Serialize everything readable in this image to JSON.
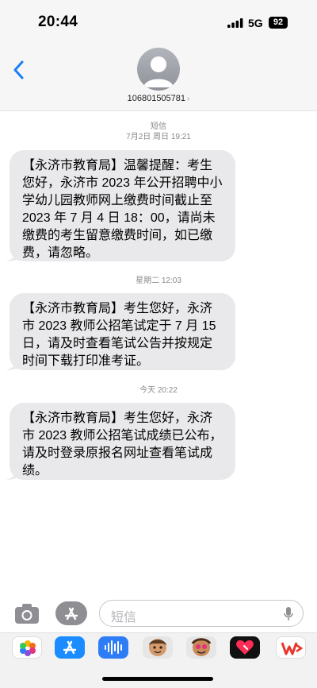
{
  "status_bar": {
    "time": "20:44",
    "network": "5G",
    "battery": "92"
  },
  "header": {
    "contact_name": "106801505781",
    "chevron": "›"
  },
  "messages": [
    {
      "meta_line1": "短信",
      "meta_line2": "7月2日 周日 19:21",
      "text": "【永济市教育局】温馨提醒：考生您好，永济市 2023 年公开招聘中小学幼儿园教师网上缴费时间截止至 2023 年 7 月 4 日 18：00，请尚未缴费的考生留意缴费时间，如已缴费，请忽略。"
    },
    {
      "meta_line1": "星期二 12:03",
      "text": "【永济市教育局】考生您好，永济市 2023 教师公招笔试定于 7 月 15 日，请及时查看笔试公告并按规定时间下载打印准考证。"
    },
    {
      "meta_line1": "今天 20:22",
      "text": "【永济市教育局】考生您好，永济市 2023 教师公招笔试成绩已公布，请及时登录原报名网址查看笔试成绩。"
    }
  ],
  "input": {
    "placeholder": "短信"
  },
  "drawer_apps": [
    {
      "name": "photos-icon",
      "color": "#ffffff"
    },
    {
      "name": "app-store-icon",
      "color": "#1a8cff"
    },
    {
      "name": "audio-message-icon",
      "color": "#2f7df6"
    },
    {
      "name": "memoji-icon",
      "color": "#e6e6e6"
    },
    {
      "name": "memoji-stickers-icon",
      "color": "#e6e6e6"
    },
    {
      "name": "digital-touch-icon",
      "color": "#111111"
    },
    {
      "name": "wps-office-icon",
      "color": "#ffffff"
    }
  ]
}
